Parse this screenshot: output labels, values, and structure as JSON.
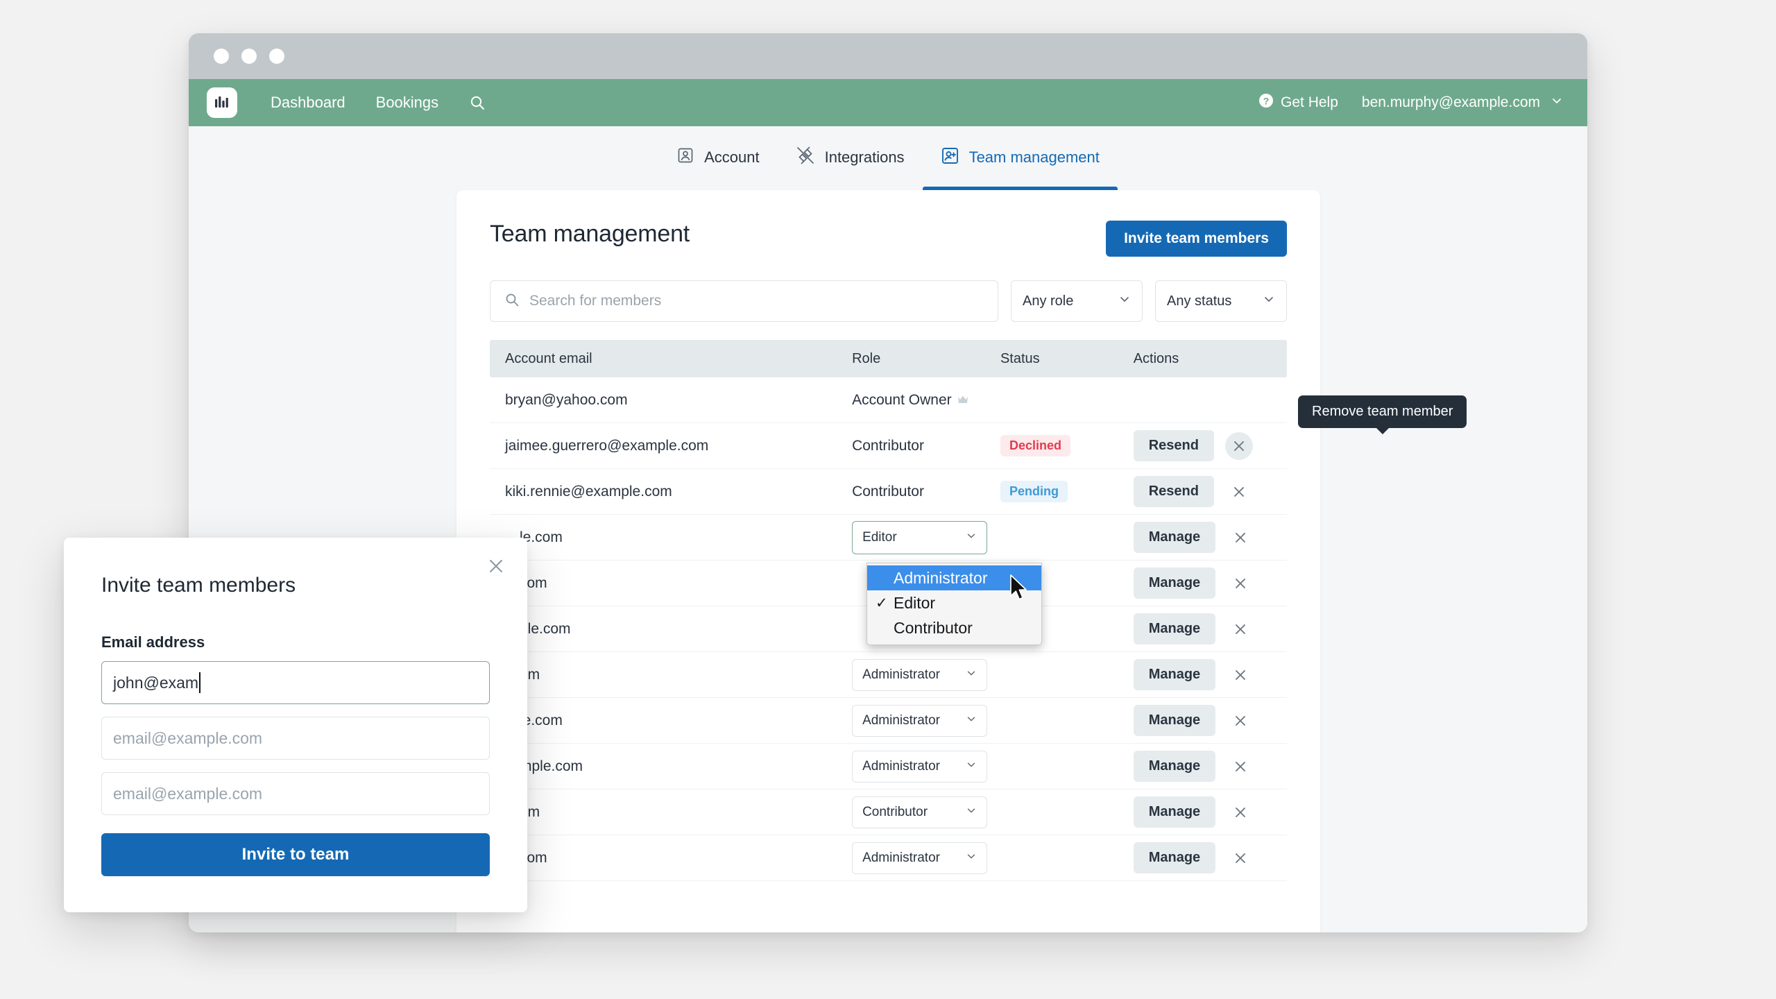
{
  "window": {
    "dots": [
      "close",
      "minimize",
      "maximize"
    ]
  },
  "appnav": {
    "logo_icon": "bar-chart-logo-icon",
    "links": [
      {
        "label": "Dashboard",
        "name": "nav-dashboard"
      },
      {
        "label": "Bookings",
        "name": "nav-bookings"
      }
    ],
    "search_icon": "search-icon",
    "help": {
      "icon": "question-circle-icon",
      "label": "Get Help"
    },
    "user": {
      "email": "ben.murphy@example.com",
      "chevron": "chevron-down-icon"
    }
  },
  "tabs": [
    {
      "label": "Account",
      "icon": "user-card-icon",
      "active": false
    },
    {
      "label": "Integrations",
      "icon": "plug-icon",
      "active": false
    },
    {
      "label": "Team management",
      "icon": "user-add-icon",
      "active": true
    }
  ],
  "main": {
    "title": "Team management",
    "invite_button": "Invite team members",
    "search": {
      "placeholder": "Search for members",
      "value": "",
      "icon": "search-icon"
    },
    "role_filter": {
      "value": "Any role",
      "chevron": "chevron-down-icon"
    },
    "status_filter": {
      "value": "Any status",
      "chevron": "chevron-down-icon"
    },
    "columns": [
      "Account email",
      "Role",
      "Status",
      "Actions"
    ],
    "rows": [
      {
        "email": "bryan@yahoo.com",
        "role_text": "Account Owner",
        "owner_icon": "crown-icon",
        "role_type": "text",
        "status": "",
        "status_type": "",
        "action": "",
        "has_x": false
      },
      {
        "email": "jaimee.guerrero@example.com",
        "role_text": "Contributor",
        "role_type": "text",
        "status": "Declined",
        "status_type": "declined",
        "action": "Resend",
        "has_x": true,
        "x_hovered": true
      },
      {
        "email": "kiki.rennie@example.com",
        "role_text": "Contributor",
        "role_type": "text",
        "status": "Pending",
        "status_type": "pending",
        "action": "Resend",
        "has_x": true,
        "x_hovered": false
      },
      {
        "email": "…le.com",
        "role_text": "Editor",
        "role_type": "select",
        "role_open": true,
        "status": "",
        "status_type": "",
        "action": "Manage",
        "has_x": true,
        "x_hovered": false
      },
      {
        "email": "…com",
        "role_text": "",
        "role_type": "select-hidden",
        "status": "",
        "status_type": "",
        "action": "Manage",
        "has_x": true,
        "x_hovered": false
      },
      {
        "email": "…ple.com",
        "role_text": "",
        "role_type": "select-hidden",
        "status": "",
        "status_type": "",
        "action": "Manage",
        "has_x": true,
        "x_hovered": false
      },
      {
        "email": "…om",
        "role_text": "Administrator",
        "role_type": "select",
        "status": "",
        "status_type": "",
        "action": "Manage",
        "has_x": true,
        "x_hovered": false
      },
      {
        "email": "…le.com",
        "role_text": "Administrator",
        "role_type": "select",
        "status": "",
        "status_type": "",
        "action": "Manage",
        "has_x": true,
        "x_hovered": false
      },
      {
        "email": "…mple.com",
        "role_text": "Administrator",
        "role_type": "select",
        "status": "",
        "status_type": "",
        "action": "Manage",
        "has_x": true,
        "x_hovered": false
      },
      {
        "email": "…om",
        "role_text": "Contributor",
        "role_type": "select",
        "status": "",
        "status_type": "",
        "action": "Manage",
        "has_x": true,
        "x_hovered": false
      },
      {
        "email": "…com",
        "role_text": "Administrator",
        "role_type": "select",
        "status": "",
        "status_type": "",
        "action": "Manage",
        "has_x": true,
        "x_hovered": false
      }
    ]
  },
  "tooltip": {
    "text": "Remove team member"
  },
  "role_dropdown": {
    "options": [
      {
        "label": "Administrator",
        "selected_highlight": true,
        "checked": false
      },
      {
        "label": "Editor",
        "selected_highlight": false,
        "checked": true
      },
      {
        "label": "Contributor",
        "selected_highlight": false,
        "checked": false
      }
    ]
  },
  "modal": {
    "title": "Invite team members",
    "close_icon": "close-icon",
    "email_label": "Email address",
    "field1_value": "john@exam",
    "field2_placeholder": "email@example.com",
    "field3_placeholder": "email@example.com",
    "submit": "Invite to team"
  },
  "colors": {
    "brand_green": "#6fa98d",
    "accent_blue": "#1569b4",
    "highlight_blue": "#3b8eea",
    "declined_red": "#e23c4e",
    "pending_blue": "#3f9ad6",
    "tooltip_dark": "#242f3a",
    "table_header_bg": "#e4eaec",
    "page_bg": "#f4f6f7"
  }
}
